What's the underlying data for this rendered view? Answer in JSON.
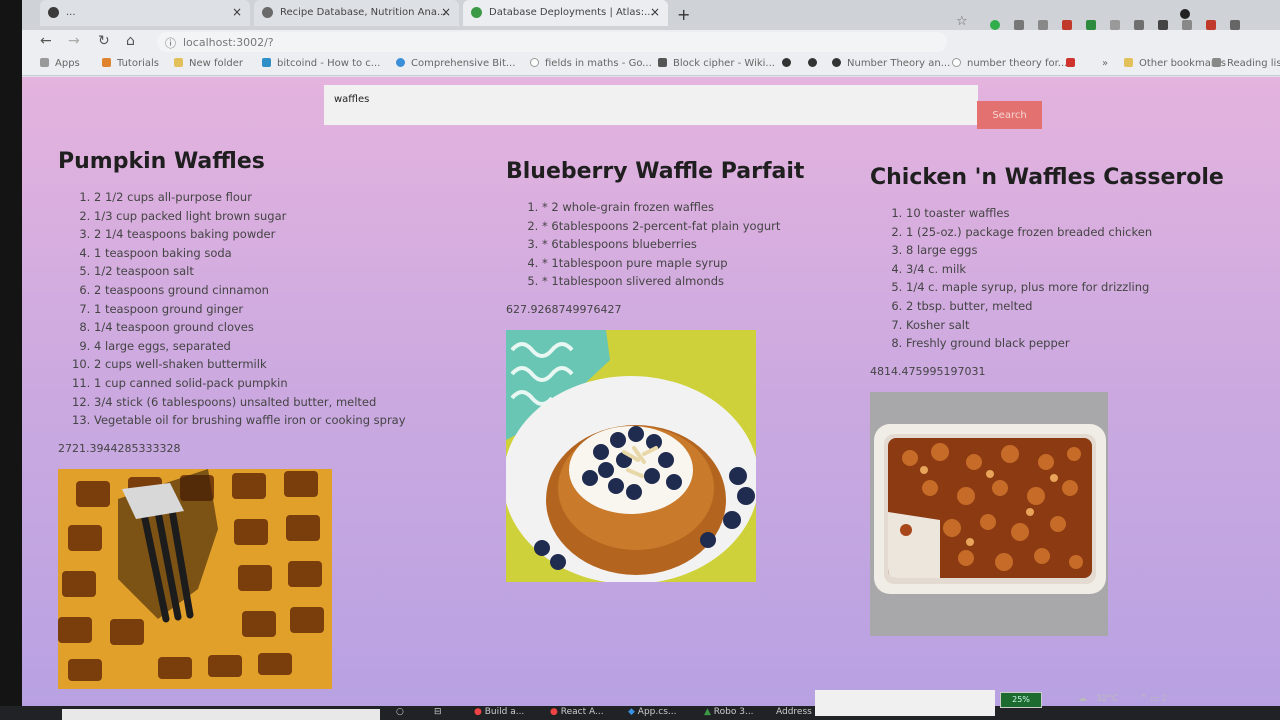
{
  "browser": {
    "tabs": [
      {
        "label": "...",
        "active": false
      },
      {
        "label": "Recipe Database, Nutrition Ana...",
        "active": false
      },
      {
        "label": "Database Deployments | Atlas:...",
        "active": true
      }
    ],
    "url": "localhost:3002/?",
    "bookmarks": [
      "Apps",
      "Tutorials",
      "New folder",
      "bitcoind - How to c...",
      "Comprehensive Bit...",
      "fields in maths - Go...",
      "Block cipher - Wiki...",
      "Number Theory an...",
      "number theory for...",
      "Other bookmarks",
      "Reading list"
    ]
  },
  "search": {
    "value": "waffles",
    "button_label": "Search"
  },
  "recipes": [
    {
      "title": "Pumpkin Waffles",
      "ingredients": [
        "2 1/2 cups all-purpose flour",
        "1/3 cup packed light brown sugar",
        "2 1/4 teaspoons baking powder",
        "1 teaspoon baking soda",
        "1/2 teaspoon salt",
        "2 teaspoons ground cinnamon",
        "1 teaspoon ground ginger",
        "1/4 teaspoon ground cloves",
        "4 large eggs, separated",
        "2 cups well-shaken buttermilk",
        "1 cup canned solid-pack pumpkin",
        "3/4 stick (6 tablespoons) unsalted butter, melted",
        "Vegetable oil for brushing waffle iron or cooking spray"
      ],
      "calories": "2721.3944285333328",
      "image": "pumpkin-waffles-photo"
    },
    {
      "title": "Blueberry Waffle Parfait",
      "ingredients": [
        "* 2 whole-grain frozen waffles",
        "* 6tablespoons 2-percent-fat plain yogurt",
        "* 6tablespoons blueberries",
        "* 1tablespoon pure maple syrup",
        "* 1tablespoon slivered almonds"
      ],
      "calories": "627.9268749976427",
      "image": "blueberry-waffle-parfait-photo"
    },
    {
      "title": "Chicken 'n Waffles Casserole",
      "ingredients": [
        "10 toaster waffles",
        "1 (25-oz.) package frozen breaded chicken",
        "8 large eggs",
        "3/4 c. milk",
        "1/4 c. maple syrup, plus more for drizzling",
        "2 tbsp. butter, melted",
        "Kosher salt",
        "Freshly ground black pepper"
      ],
      "calories": "4814.475995197031",
      "image": "chicken-waffles-casserole-photo"
    }
  ],
  "taskbar": {
    "items": [
      "Build a...",
      "React A...",
      "App.cs...",
      "Robo 3..."
    ],
    "address_label": "Address",
    "battery": "25%",
    "temperature": "32°C"
  }
}
